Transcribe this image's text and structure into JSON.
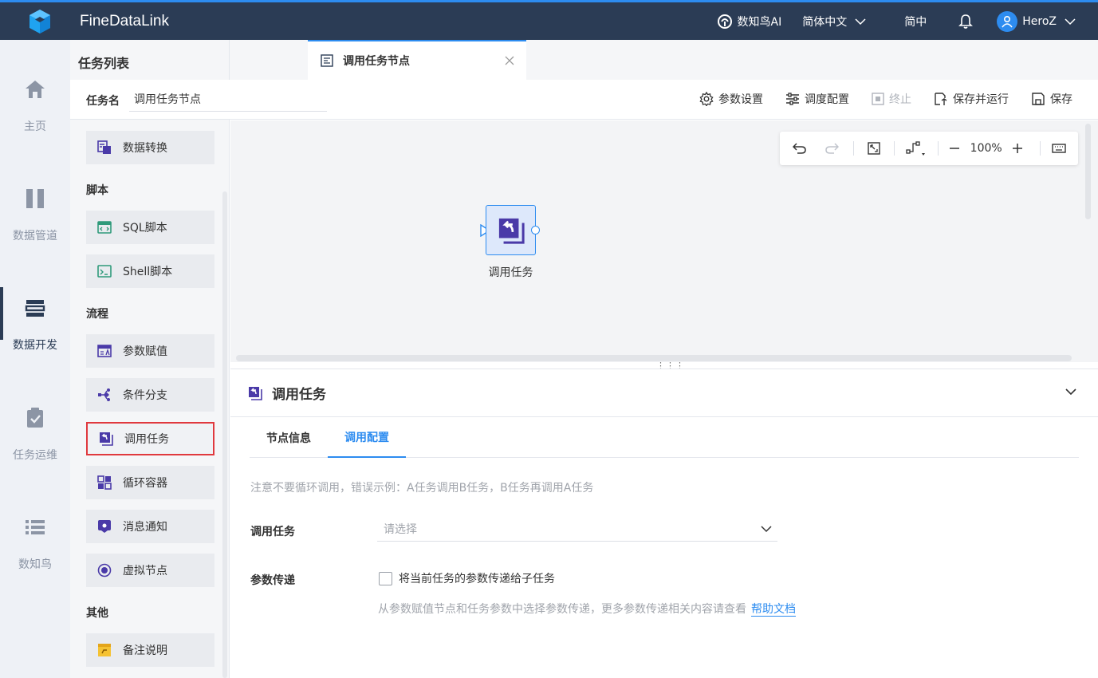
{
  "app": {
    "title": "FineDataLink"
  },
  "topbar": {
    "ai_label": "数知鸟AI",
    "language": "简体中文",
    "lang_short": "简中",
    "user_name": "HeroZ"
  },
  "leftnav": {
    "items": [
      {
        "label": "主页",
        "icon": "home-icon"
      },
      {
        "label": "数据管道",
        "icon": "pipeline-icon"
      },
      {
        "label": "数据开发",
        "icon": "data-dev-icon",
        "active": true
      },
      {
        "label": "任务运维",
        "icon": "task-ops-icon"
      },
      {
        "label": "数知鸟",
        "icon": "list-icon"
      }
    ]
  },
  "tasklist": {
    "title": "任务列表",
    "groups": {
      "script": "脚本",
      "flow": "流程",
      "other": "其他"
    },
    "nodes": {
      "data_transform": "数据转换",
      "sql_script": "SQL脚本",
      "shell_script": "Shell脚本",
      "param_assign": "参数赋值",
      "cond_branch": "条件分支",
      "call_task": "调用任务",
      "loop_container": "循环容器",
      "message": "消息通知",
      "virtual_node": "虚拟节点",
      "remark": "备注说明"
    }
  },
  "tab": {
    "label": "调用任务节点"
  },
  "task": {
    "name_label": "任务名",
    "name_value": "调用任务节点"
  },
  "toolbar": {
    "param_settings": "参数设置",
    "schedule_config": "调度配置",
    "stop": "终止",
    "save_run": "保存并运行",
    "save": "保存"
  },
  "canvas": {
    "zoom": "100%",
    "node_label": "调用任务"
  },
  "panel": {
    "title": "调用任务",
    "tabs": [
      "节点信息",
      "调用配置"
    ],
    "active_tab": "调用配置",
    "notice": "注意不要循环调用，错误示例：A任务调用B任务，B任务再调用A任务",
    "call_task_label": "调用任务",
    "call_task_placeholder": "请选择",
    "param_label": "参数传递",
    "param_checkbox": "将当前任务的参数传递给子任务",
    "hint": "从参数赋值节点和任务参数中选择参数传递，更多参数传递相关内容请查看",
    "help_link": "帮助文档"
  },
  "colors": {
    "topbar": "#2b3c55",
    "accent": "#2d8cf0",
    "selected_border": "#e0393e",
    "icon_purple": "#4a3aa8"
  }
}
